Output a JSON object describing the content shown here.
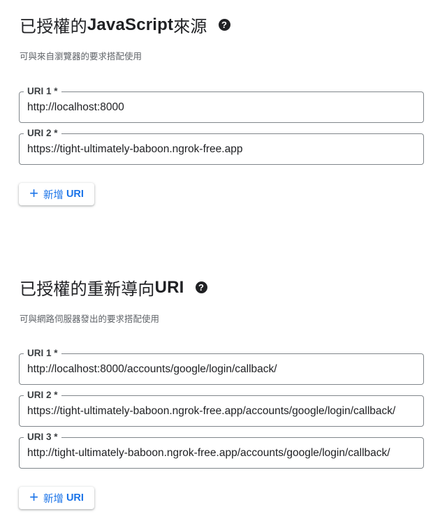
{
  "js_origins": {
    "title_prefix": "已授權的 ",
    "title_bold": "JavaScript",
    "title_suffix": " 來源",
    "help_icon": "?",
    "description": "可與來自瀏覽器的要求搭配使用",
    "fields": [
      {
        "label": "URI 1 *",
        "value": "http://localhost:8000"
      },
      {
        "label": "URI 2 *",
        "value": "https://tight-ultimately-baboon.ngrok-free.app"
      }
    ],
    "add_button": {
      "icon": "+",
      "label_zh": "新增",
      "label_en": "URI"
    }
  },
  "redirect_uris": {
    "title_prefix": "已授權的重新導向 ",
    "title_bold": "URI",
    "help_icon": "?",
    "description": "可與網路伺服器發出的要求搭配使用",
    "fields": [
      {
        "label": "URI 1 *",
        "value": "http://localhost:8000/accounts/google/login/callback/"
      },
      {
        "label": "URI 2 *",
        "value": "https://tight-ultimately-baboon.ngrok-free.app/accounts/google/login/callback/"
      },
      {
        "label": "URI 3 *",
        "value": "http://tight-ultimately-baboon.ngrok-free.app/accounts/google/login/callback/"
      }
    ],
    "add_button": {
      "icon": "+",
      "label_zh": "新增",
      "label_en": "URI"
    }
  },
  "colors": {
    "accent": "#1a73e8",
    "text": "#202124",
    "muted": "#5f6368",
    "border": "#80868b"
  }
}
